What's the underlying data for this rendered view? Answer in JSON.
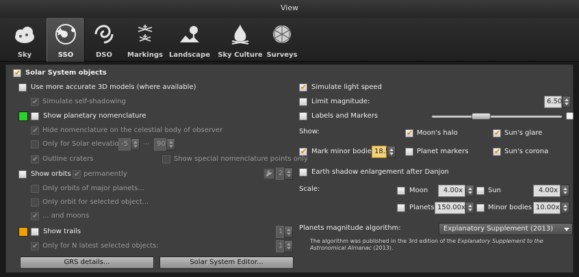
{
  "window": {
    "title": "View"
  },
  "tabs": [
    {
      "label": "Sky",
      "icon": "sky-icon"
    },
    {
      "label": "SSO",
      "icon": "sso-icon",
      "active": true
    },
    {
      "label": "DSO",
      "icon": "galaxy-icon"
    },
    {
      "label": "Markings",
      "icon": "markings-icon"
    },
    {
      "label": "Landscape",
      "icon": "landscape-icon"
    },
    {
      "label": "Sky Culture",
      "icon": "sky-culture-icon"
    },
    {
      "label": "Surveys",
      "icon": "surveys-icon"
    }
  ],
  "left": {
    "solar_system_objects": "Solar System objects",
    "use_3d_models": "Use more accurate 3D models (where available)",
    "simulate_self_shadowing": "Simulate self-shadowing",
    "show_planetary_nomenclature": "Show planetary nomenclature",
    "hide_nomenclature": "Hide nomenclature on the celestial body of observer",
    "only_for_solar_elevation": "Only for Solar elevation",
    "elev_min": "-5",
    "elev_sep": "...",
    "elev_max": "90",
    "outline_craters": "Outline craters",
    "show_special_points": "Show special nomenclature points only",
    "show_orbits": "Show orbits",
    "permanently": "permanently",
    "orbit_width": "2",
    "only_orbits_major": "Only orbits of major planets...",
    "only_orbit_selected": "Only orbit for selected object...",
    "and_moons": "... and moons",
    "show_trails": "Show trails",
    "trails_width": "1",
    "only_n_latest": "Only for N latest selected objects:",
    "n_latest_value": "1",
    "grs_button": "GRS details...",
    "editor_button": "Solar System Editor...",
    "nomenclature_color": "#2bd12b",
    "trails_color": "#f0a000"
  },
  "right": {
    "simulate_light_speed": "Simulate light speed",
    "limit_magnitude": "Limit magnitude:",
    "limit_magnitude_value": "6.50",
    "labels_and_markers": "Labels and Markers",
    "labels_slider_level": 0.36,
    "show_label": "Show:",
    "moons_halo": "Moon's halo",
    "suns_glare": "Sun's glare",
    "mark_minor_bodies": "Mark minor bodies",
    "minor_bodies_value": "18.5",
    "planet_markers": "Planet markers",
    "suns_corona": "Sun's corona",
    "earth_shadow": "Earth shadow enlargement after Danjon",
    "scale_label": "Scale:",
    "moon": "Moon",
    "moon_scale": "4.00x",
    "sun": "Sun",
    "sun_scale": "4.00x",
    "planets": "Planets",
    "planets_scale": "150.00x",
    "minor_bodies": "Minor bodies",
    "minor_bodies_scale": "10.00x",
    "planets_magnitude_algorithm": "Planets magnitude algorithm:",
    "algorithm_value": "Explanatory Supplement (2013)",
    "note_prefix": "The algorithm was published in the 3rd edition of the ",
    "note_book": "Explanatory Supplement to the Astronomical Almanac",
    "note_suffix": " (2013)."
  }
}
